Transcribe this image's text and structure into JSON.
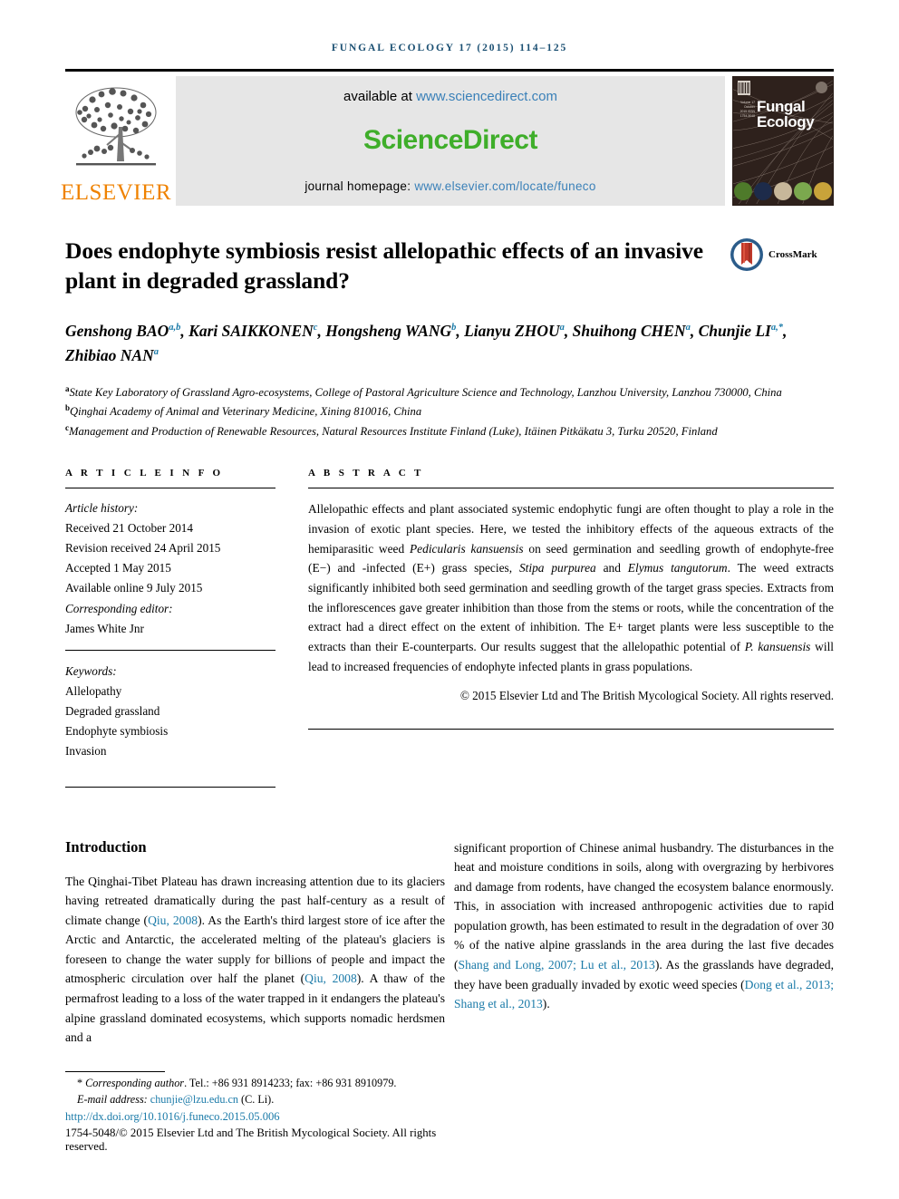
{
  "running_head": "FUNGAL ECOLOGY 17 (2015) 114–125",
  "masthead": {
    "publisher_name": "ELSEVIER",
    "available_at_label": "available at ",
    "sciencedirect_url": "www.sciencedirect.com",
    "sciencedirect_wordmark": "ScienceDirect",
    "homepage_label": "journal homepage: ",
    "homepage_url": "www.elsevier.com/locate/funeco",
    "cover_title_line1": "Fungal",
    "cover_title_line2": "Ecology",
    "cover_sidetext": "Volume 17 October 2015 ISSN 1754-5048",
    "colors": {
      "band_background": "#e6e6e6",
      "sciencedirect_green": "#3fae2a",
      "link_blue": "#3a80b8",
      "elsevier_orange": "#ef8200",
      "cover_background": "#2e211c"
    }
  },
  "crossmark": {
    "label": "CrossMark"
  },
  "title": "Does endophyte symbiosis resist allelopathic effects of an invasive plant in degraded grassland?",
  "authors": [
    {
      "name": "Genshong BAO",
      "display": "Genshong BAO",
      "sup": "a,b"
    },
    {
      "name": "Kari SAIKKONEN",
      "display": "Kari SAIKKONEN",
      "sup": "c"
    },
    {
      "name": "Hongsheng WANG",
      "display": "Hongsheng WANG",
      "sup": "b"
    },
    {
      "name": "Lianyu ZHOU",
      "display": "Lianyu ZHOU",
      "sup": "a"
    },
    {
      "name": "Shuihong CHEN",
      "display": "Shuihong CHEN",
      "sup": "a"
    },
    {
      "name": "Chunjie LI",
      "display": "Chunjie LI",
      "sup": "a,*"
    },
    {
      "name": "Zhibiao NAN",
      "display": "Zhibiao NAN",
      "sup": "a"
    }
  ],
  "affiliations": [
    {
      "marker": "a",
      "text": "State Key Laboratory of Grassland Agro-ecosystems, College of Pastoral Agriculture Science and Technology, Lanzhou University, Lanzhou 730000, China"
    },
    {
      "marker": "b",
      "text": "Qinghai Academy of Animal and Veterinary Medicine, Xining 810016, China"
    },
    {
      "marker": "c",
      "text": "Management and Production of Renewable Resources, Natural Resources Institute Finland (Luke), Itäinen Pitkäkatu 3, Turku 20520, Finland"
    }
  ],
  "article_info": {
    "heading": "A R T I C L E  I N F O",
    "history_label": "Article history:",
    "history": [
      "Received 21 October 2014",
      "Revision received 24 April 2015",
      "Accepted 1 May 2015",
      "Available online 9 July 2015"
    ],
    "corresponding_editor_label": "Corresponding editor:",
    "corresponding_editor": "James White Jnr",
    "keywords_label": "Keywords:",
    "keywords": [
      "Allelopathy",
      "Degraded grassland",
      "Endophyte symbiosis",
      "Invasion"
    ]
  },
  "abstract": {
    "heading": "A B S T R A C T",
    "paragraph_parts": [
      {
        "text": "Allelopathic effects and plant associated systemic endophytic fungi are often thought to play a role in the invasion of exotic plant species. Here, we tested the inhibitory effects of the aqueous extracts of the hemiparasitic weed ",
        "italic": false
      },
      {
        "text": "Pedicularis kansuensis",
        "italic": true
      },
      {
        "text": " on seed germination and seedling growth of endophyte-free (E−) and -infected (E+) grass species, ",
        "italic": false
      },
      {
        "text": "Stipa purpurea",
        "italic": true
      },
      {
        "text": " and ",
        "italic": false
      },
      {
        "text": "Elymus tangutorum",
        "italic": true
      },
      {
        "text": ". The weed extracts significantly inhibited both seed germination and seedling growth of the target grass species. Extracts from the inflorescences gave greater inhibition than those from the stems or roots, while the concentration of the extract had a direct effect on the extent of inhibition. The E+ target plants were less susceptible to the extracts than their E-counterparts. Our results suggest that the allelopathic potential of ",
        "italic": false
      },
      {
        "text": "P. kansuensis",
        "italic": true
      },
      {
        "text": " will lead to increased frequencies of endophyte infected plants in grass populations.",
        "italic": false
      }
    ],
    "copyright": "© 2015 Elsevier Ltd and The British Mycological Society. All rights reserved."
  },
  "introduction": {
    "heading": "Introduction",
    "left_parts": [
      {
        "text": "The Qinghai-Tibet Plateau has drawn increasing attention due to its glaciers having retreated dramatically during the past half-century as a result of climate change (",
        "link": false
      },
      {
        "text": "Qiu, 2008",
        "link": true
      },
      {
        "text": "). As the Earth's third largest store of ice after the Arctic and Antarctic, the accelerated melting of the plateau's glaciers is foreseen to change the water supply for billions of people and impact the atmospheric circulation over half the planet (",
        "link": false
      },
      {
        "text": "Qiu, 2008",
        "link": true
      },
      {
        "text": "). A thaw of the permafrost leading to a loss of the water trapped in it endangers the plateau's alpine grassland dominated ecosystems, which supports nomadic herdsmen and a",
        "link": false
      }
    ],
    "right_parts": [
      {
        "text": "significant proportion of Chinese animal husbandry. The disturbances in the heat and moisture conditions in soils, along with overgrazing by herbivores and damage from rodents, have changed the ecosystem balance enormously. This, in association with increased anthropogenic activities due to rapid population growth, has been estimated to result in the degradation of over 30 % of the native alpine grasslands in the area during the last five decades (",
        "link": false
      },
      {
        "text": "Shang and Long, 2007; Lu et al., 2013",
        "link": true
      },
      {
        "text": "). As the grasslands have degraded, they have been gradually invaded by exotic weed species (",
        "link": false
      },
      {
        "text": "Dong et al., 2013; Shang et al., 2013",
        "link": true
      },
      {
        "text": ").",
        "link": false
      }
    ]
  },
  "footnotes": {
    "corresponding_marker": "*",
    "corresponding_text": "Corresponding author",
    "corresponding_contact": ". Tel.: +86 931 8914233; fax: +86 931 8910979.",
    "email_label": "E-mail address: ",
    "email": "chunjie@lzu.edu.cn",
    "email_owner": " (C. Li).",
    "doi": "http://dx.doi.org/10.1016/j.funeco.2015.05.006",
    "issn_line": "1754-5048/© 2015 Elsevier Ltd and The British Mycological Society. All rights reserved."
  }
}
